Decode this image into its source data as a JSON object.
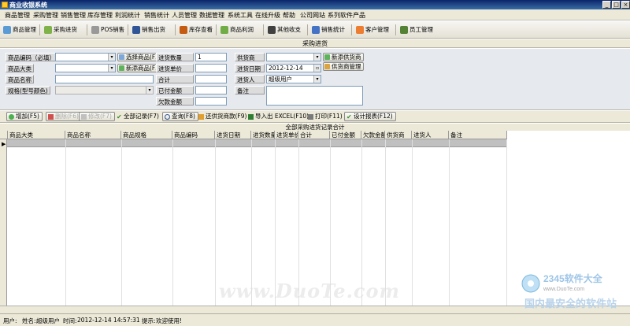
{
  "window": {
    "title": "商业收银系统"
  },
  "menu": [
    "商品管理",
    "采购管理",
    "销售管理",
    "库存管理",
    "利润统计",
    "销售统计",
    "人员管理",
    "数据管理",
    "系统工具",
    "在线升级",
    "帮助",
    "公司网站",
    "系列软件产品"
  ],
  "toolbar": [
    "商品管理",
    "采购进货",
    "POS销售",
    "销售出货",
    "库存查看",
    "商品利润",
    "其他收支",
    "销售统计",
    "客户管理",
    "员工管理"
  ],
  "section_title": "采购进货",
  "form": {
    "product_code_label": "商品编码（必填）",
    "select_product_btn": "选择商品(F2)",
    "new_product_btn": "新添商品(F3)",
    "category_label": "商品大类",
    "name_label": "商品名称",
    "spec_label": "规格(型号颜色)",
    "qty_label": "进货数量",
    "qty_value": "1",
    "unit_price_label": "进货单价",
    "total_label": "合计",
    "paid_label": "已付金额",
    "owed_label": "欠款金额",
    "supplier_label": "供货商",
    "new_supplier_btn": "新添供货商",
    "supplier_mgmt_btn": "供货商管理",
    "date_label": "进货日期",
    "date_value": "2012-12-14",
    "buyer_label": "进货人",
    "buyer_value": "超级用户",
    "remark_label": "备注"
  },
  "actions": [
    "增加(F5)",
    "删除(F6)",
    "修改(F7)",
    "全部记录(F7)",
    "查询(F8)",
    "还供货商款(F9)",
    "导入出 EXCEL(F10)",
    "打印(F11)",
    "设计报表(F12)"
  ],
  "total_title": "全部采购进货记录合计",
  "grid": {
    "columns": [
      "商品大类",
      "商品名称",
      "商品规格",
      "商品编码",
      "进货日期",
      "进货数量",
      "进货单价",
      "合计",
      "已付金额",
      "欠款金额",
      "供货商",
      "进货人",
      "备注"
    ]
  },
  "status": {
    "user_label": "用户:",
    "name_label": "姓名:",
    "name_value": "超级用户",
    "time_label": "时间:",
    "time_value": "2012-12-14 14:57:31",
    "hint_label": "提示:",
    "hint_value": "欢迎使用!"
  },
  "watermark": {
    "text": "www.DuoTe.com",
    "brand": "2345软件大全",
    "slogan": "国内最安全的软件站",
    "url": "www.DuoTe.com"
  },
  "colors": {
    "titlebar": "#0a246a",
    "panel": "#e6e9ee",
    "toolbar": "#ece9d8",
    "selected_row": "#c0c0c0"
  }
}
